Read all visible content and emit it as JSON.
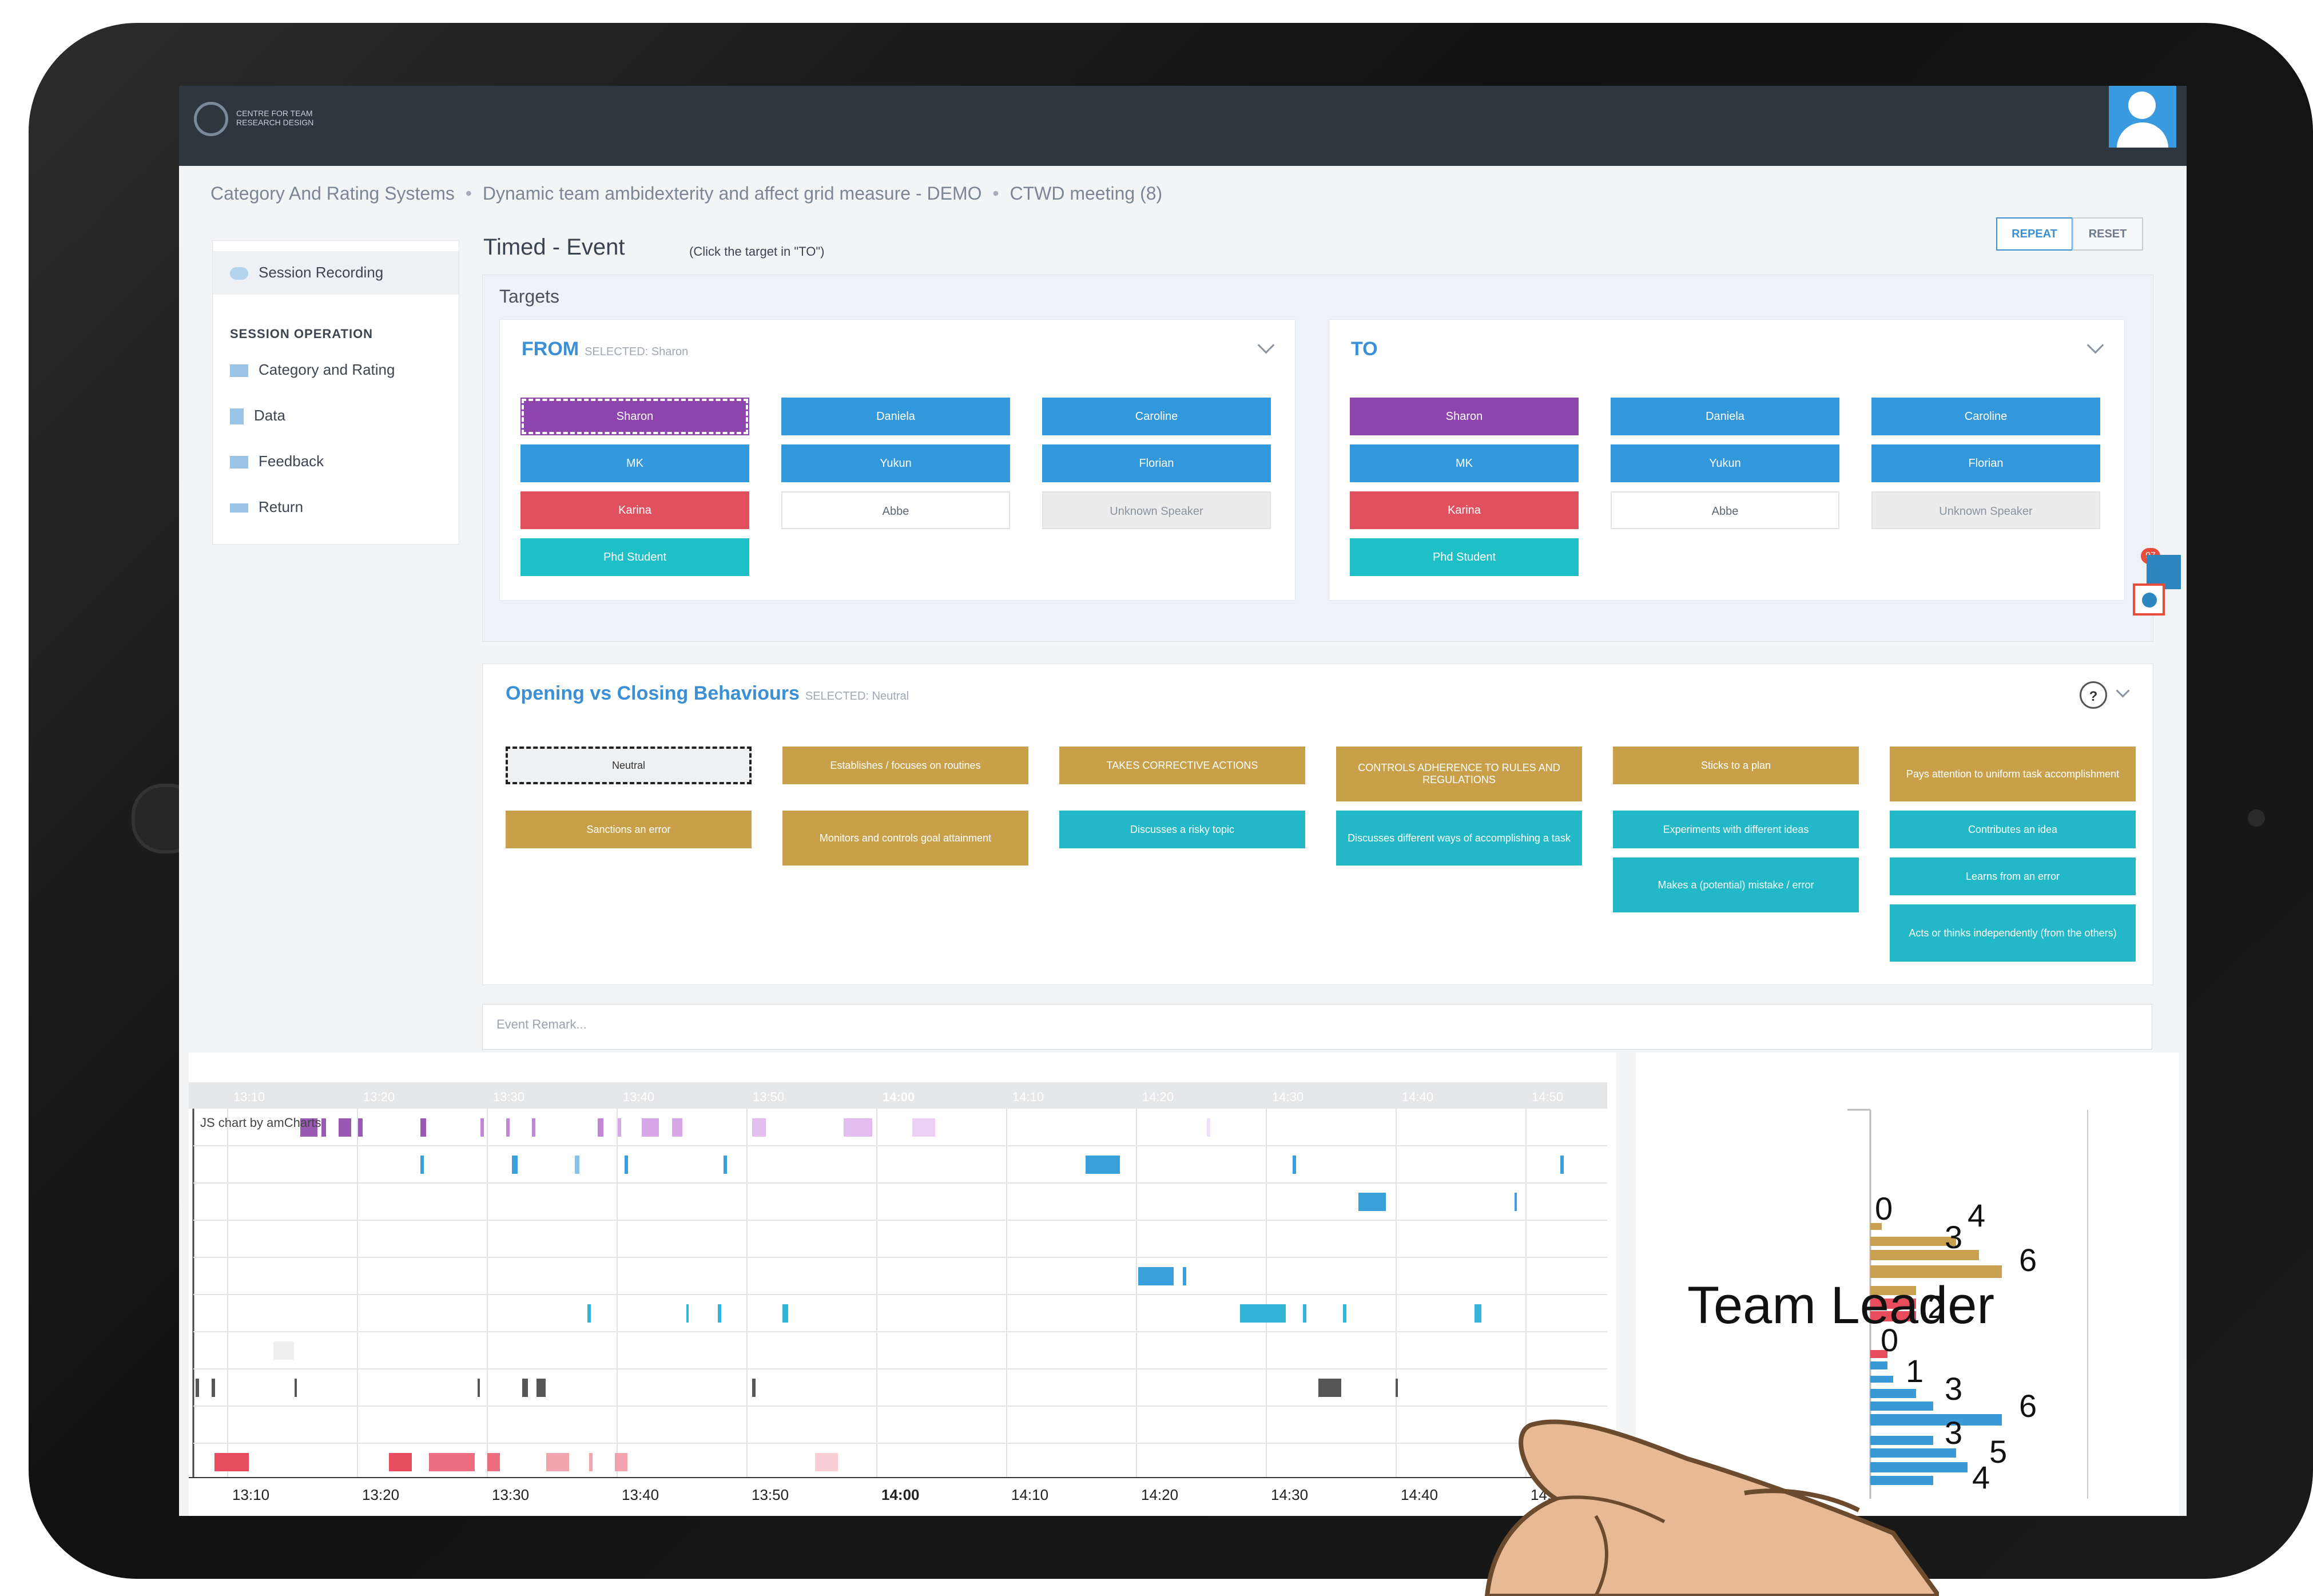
{
  "header": {
    "logo_text": "CENTRE FOR TEAM RESEARCH DESIGN",
    "breadcrumb": [
      "Category And Rating Systems",
      "Dynamic team ambidexterity and affect grid measure - DEMO",
      "CTWD meeting (8)"
    ]
  },
  "buttons": {
    "repeat": "REPEAT",
    "reset": "RESET"
  },
  "sidebar": {
    "recording": "Session Recording",
    "section": "SESSION OPERATION",
    "items": [
      "Category and Rating",
      "Data",
      "Feedback",
      "Return"
    ]
  },
  "main": {
    "title": "Timed - Event",
    "hint": "(Click the target in \"TO\")",
    "targets_label": "Targets",
    "from": {
      "title": "FROM",
      "selected": "SELECTED: Sharon"
    },
    "to": {
      "title": "TO"
    },
    "people": [
      "Sharon",
      "Daniela",
      "Caroline",
      "MK",
      "Yukun",
      "Florian",
      "Karina",
      "Abbe",
      "Unknown Speaker",
      "Phd Student"
    ],
    "behaviours": {
      "title": "Opening vs Closing Behaviours",
      "selected": "SELECTED: Neutral",
      "help": "?",
      "items": [
        "Neutral",
        "Establishes / focuses on routines",
        "TAKES CORRECTIVE ACTIONS",
        "CONTROLS ADHERENCE TO RULES AND REGULATIONS",
        "Sticks to a plan",
        "Pays attention to uniform task accomplishment",
        "Sanctions an error",
        "Monitors and controls goal attainment",
        "Discusses a risky topic",
        "Discusses different ways of accomplishing a task",
        "Experiments with different ideas",
        "Contributes an idea",
        "Makes a (potential) mistake / error",
        "Learns from an error",
        "Acts or thinks independently (from the others)"
      ]
    },
    "remark_placeholder": "Event Remark...",
    "notification_count": "97"
  },
  "timeline": {
    "credit": "JS chart by amCharts",
    "ticks": [
      "13:10",
      "13:20",
      "13:30",
      "13:40",
      "13:50",
      "14:00",
      "14:10",
      "14:20",
      "14:30",
      "14:40",
      "14:50"
    ],
    "bold_tick": "14:00"
  },
  "team_chart": {
    "label": "Team Leader",
    "values": [
      "0",
      "3",
      "4",
      "6",
      "2",
      "0",
      "1",
      "3",
      "6",
      "3",
      "4",
      "5"
    ]
  },
  "colors": {
    "topbar": "#2e3640",
    "accent_blue": "#3398db",
    "purple": "#8e44ad",
    "red": "#e0505e",
    "teal": "#1fbfc8",
    "gold": "#c9a04a"
  }
}
